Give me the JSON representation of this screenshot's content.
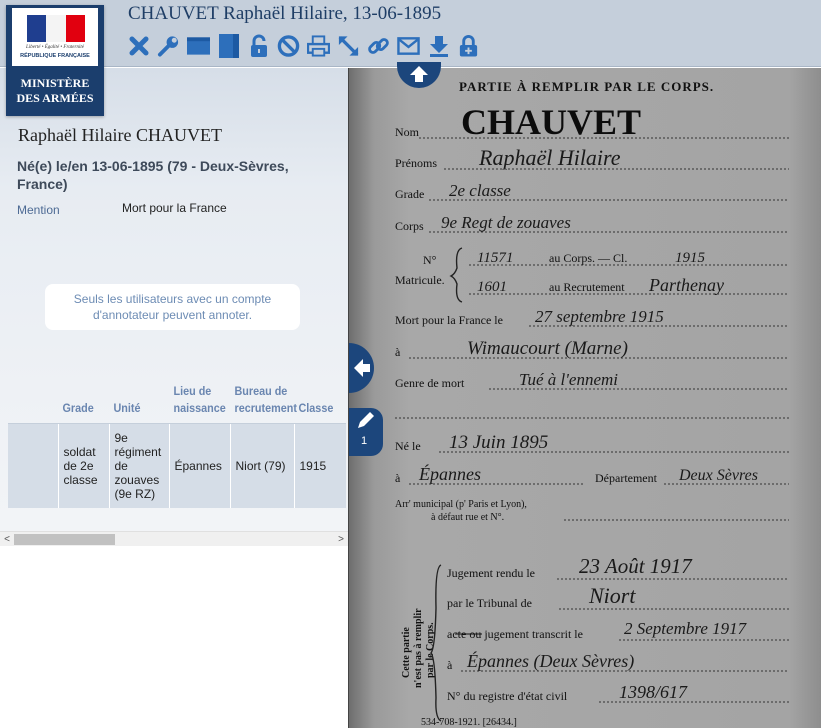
{
  "header": {
    "title": "CHAUVET Raphaël Hilaire, 13-06-1895",
    "tools": [
      {
        "icon": "close-icon"
      },
      {
        "icon": "wrench-icon"
      },
      {
        "icon": "layout-horizontal-icon"
      },
      {
        "icon": "layout-vertical-icon"
      },
      {
        "icon": "lock-icon"
      },
      {
        "icon": "forbidden-icon"
      },
      {
        "icon": "print-icon"
      },
      {
        "icon": "resize-icon"
      },
      {
        "icon": "link-icon"
      },
      {
        "icon": "mail-icon"
      },
      {
        "icon": "download-icon"
      },
      {
        "icon": "add-lock-icon"
      }
    ]
  },
  "logo": {
    "motto": "Liberté • Égalité • Fraternité",
    "republic": "RÉPUBLIQUE FRANÇAISE",
    "ministry_line1": "MINISTÈRE",
    "ministry_line2": "DES ARMÉES"
  },
  "record": {
    "name": "Raphaël Hilaire CHAUVET",
    "birth": "Né(e) le/en 13-06-1895 (79 - Deux-Sèvres, France)",
    "mention_label": "Mention",
    "mention_value": "Mort pour la France",
    "notice": "Seuls les utilisateurs avec un compte d'annotateur peuvent annoter."
  },
  "table": {
    "headers": [
      "",
      "Grade",
      "Unité",
      "Lieu de naissance",
      "Bureau de recrutement",
      "Classe"
    ],
    "row": [
      "",
      "soldat de 2e classe",
      "9e régiment de zouaves (9e RZ)",
      "Épannes",
      "Niort (79)",
      "1915"
    ]
  },
  "scrollbar": {
    "left_arrow": "<",
    "right_arrow": ">"
  },
  "viewer": {
    "annotation_count": "1",
    "document": {
      "heading": "PARTIE À REMPLIR PAR LE CORPS.",
      "nom_label": "Nom",
      "nom_value": "CHAUVET",
      "prenoms_label": "Prénoms",
      "prenoms_value": "Raphaël Hilaire",
      "grade_label": "Grade",
      "grade_value": "2e classe",
      "corps_label": "Corps",
      "corps_value": "9e Regt de zouaves",
      "no_label": "N°",
      "matricule_label": "Matricule.",
      "matricule_corps": "11571",
      "au_corps": "au Corps. — Cl.",
      "classe_value": "1915",
      "matricule_recrutement": "1601",
      "au_recrutement": "au Recrutement",
      "recrutement_value": "Parthenay",
      "mort_label": "Mort pour la France le",
      "mort_value": "27 septembre 1915",
      "a_label": "à",
      "lieu_value": "Wimaucourt (Marne)",
      "genre_label": "Genre de mort",
      "genre_value": "Tué à l'ennemi",
      "ne_label": "Né le",
      "ne_value": "13 Juin 1895",
      "ne_a_label": "à",
      "ne_lieu_value": "Épannes",
      "departement_label": "Département",
      "departement_value": "Deux Sèvres",
      "arr_label": "Arr' municipal (p' Paris et Lyon),",
      "arr_label2": "à défaut rue et N°.",
      "side_label_1": "Cette partie",
      "side_label_2": "n'est pas à remplir",
      "side_label_3": "par le Corps.",
      "jugement_label": "Jugement rendu le",
      "jugement_value": "23 Août 1917",
      "tribunal_label": "par le Tribunal de",
      "tribunal_value": "Niort",
      "transcrit_label": "acte ou jugement transcrit le",
      "transcrit_value": "2 Septembre 1917",
      "transcrit_a_label": "à",
      "transcrit_lieu_value": "Épannes (Deux Sèvres)",
      "registre_label": "N° du registre d'état civil",
      "registre_value": "1398/617",
      "footer": "534-708-1921. [26434.]"
    }
  }
}
